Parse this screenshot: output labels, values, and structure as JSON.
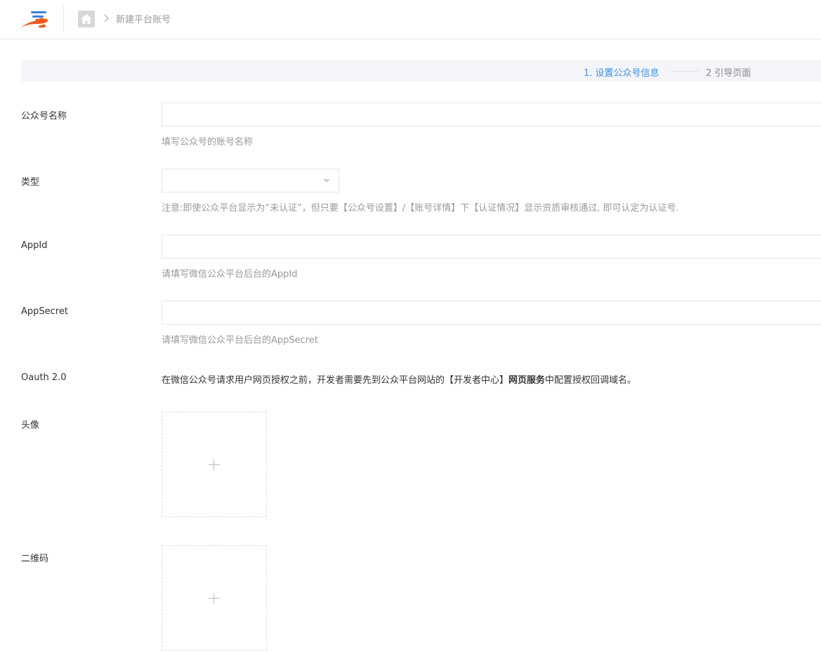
{
  "header": {
    "breadcrumb_current": "新建平台账号"
  },
  "steps": {
    "step1": "1. 设置公众号信息",
    "step2": "2 引导页面",
    "active_color": "#3d8fe0"
  },
  "form": {
    "name": {
      "label": "公众号名称",
      "value": "",
      "hint": "填写公众号的账号名称"
    },
    "type": {
      "label": "类型",
      "value": "",
      "hint": "注意:即使公众平台显示为“未认证”，但只要【公众号设置】/【账号详情】下【认证情况】显示资质审核通过, 即可认定为认证号."
    },
    "appid": {
      "label": "AppId",
      "value": "",
      "hint": "请填写微信公众平台后台的AppId"
    },
    "appsecret": {
      "label": "AppSecret",
      "value": "",
      "hint": "请填写微信公众平台后台的AppSecret"
    },
    "oauth": {
      "label": "Oauth 2.0",
      "text_before": "在微信公众号请求用户网页授权之前，开发者需要先到公众平台网站的【开发者中心】",
      "text_bold": "网页服务",
      "text_after": "中配置授权回调域名。"
    },
    "avatar": {
      "label": "头像"
    },
    "qrcode": {
      "label": "二维码"
    }
  },
  "icons": {
    "logo": "cloud-logo-icon",
    "home": "home-icon",
    "breadcrumb_separator": "chevron-right-icon",
    "select_caret": "caret-down-icon",
    "upload": "plus-icon"
  }
}
